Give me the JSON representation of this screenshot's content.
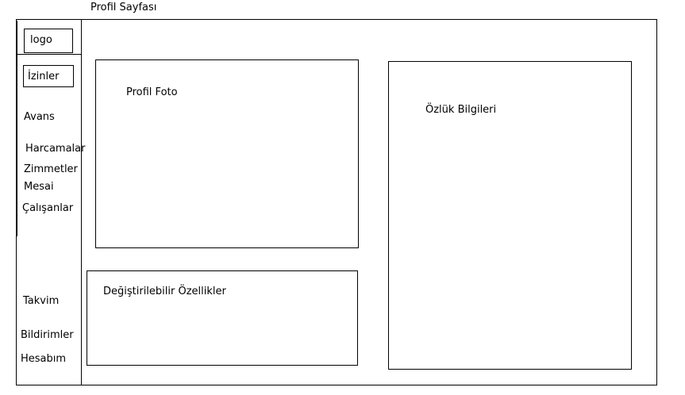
{
  "page": {
    "title": "Profil Sayfası"
  },
  "sidebar": {
    "logo": "logo",
    "items": [
      {
        "label": "İzinler"
      },
      {
        "label": "Avans"
      },
      {
        "label": "Harcamalar"
      },
      {
        "label": "Zimmetler"
      },
      {
        "label": "Mesai"
      },
      {
        "label": "Çalışanlar"
      },
      {
        "label": "Takvim"
      },
      {
        "label": "Bildirimler"
      },
      {
        "label": "Hesabım"
      }
    ]
  },
  "main": {
    "profile_photo": {
      "label": "Profil Foto"
    },
    "personal_info": {
      "label": "Özlük Bilgileri"
    },
    "editable_properties": {
      "label": "Değiştirilebilir Özellikler"
    }
  }
}
